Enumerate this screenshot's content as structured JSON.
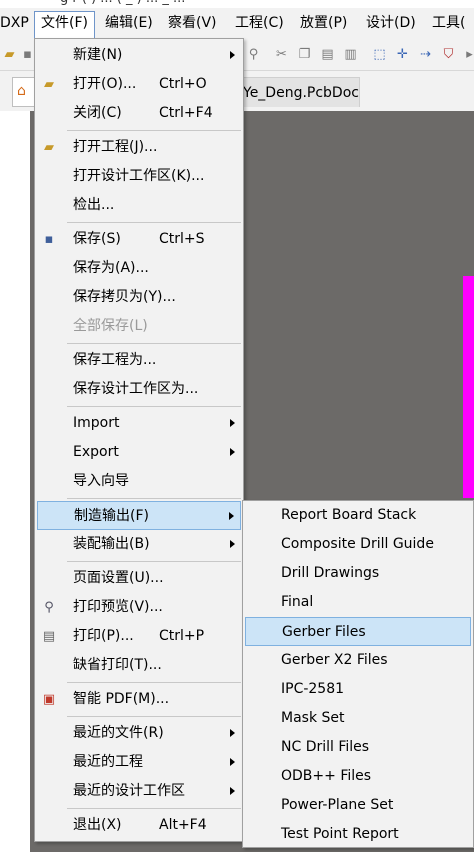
{
  "menubar": {
    "items": [
      "DXP",
      "文件(F)",
      "编辑(E)",
      "察看(V)",
      "工程(C)",
      "放置(P)",
      "设计(D)",
      "工具("
    ]
  },
  "tabs": {
    "document": "Ye_Deng.PcbDoc"
  },
  "file_menu": {
    "items": [
      {
        "label": "新建(N)",
        "shortcut": "",
        "submenu": true
      },
      {
        "label": "打开(O)...",
        "shortcut": "Ctrl+O",
        "icon": "open-folder-icon"
      },
      {
        "label": "关闭(C)",
        "shortcut": "Ctrl+F4"
      },
      {
        "label": "打开工程(J)...",
        "icon": "open-project-icon"
      },
      {
        "label": "打开设计工作区(K)..."
      },
      {
        "label": "检出..."
      },
      {
        "label": "保存(S)",
        "shortcut": "Ctrl+S",
        "icon": "save-icon"
      },
      {
        "label": "保存为(A)..."
      },
      {
        "label": "保存拷贝为(Y)..."
      },
      {
        "label": "全部保存(L)",
        "disabled": true
      },
      {
        "label": "保存工程为..."
      },
      {
        "label": "保存设计工作区为..."
      },
      {
        "label": "Import",
        "submenu": true
      },
      {
        "label": "Export",
        "submenu": true
      },
      {
        "label": "导入向导"
      },
      {
        "label": "制造输出(F)",
        "submenu": true,
        "highlighted": true
      },
      {
        "label": "装配输出(B)",
        "submenu": true
      },
      {
        "label": "页面设置(U)..."
      },
      {
        "label": "打印预览(V)...",
        "icon": "print-preview-icon"
      },
      {
        "label": "打印(P)...",
        "shortcut": "Ctrl+P",
        "icon": "printer-icon"
      },
      {
        "label": "缺省打印(T)..."
      },
      {
        "label": "智能 PDF(M)...",
        "icon": "pdf-icon"
      },
      {
        "label": "最近的文件(R)",
        "submenu": true
      },
      {
        "label": "最近的工程",
        "submenu": true
      },
      {
        "label": "最近的设计工作区",
        "submenu": true
      },
      {
        "label": "退出(X)",
        "shortcut": "Alt+F4"
      }
    ]
  },
  "fabrication_submenu": {
    "items": [
      {
        "label": "Report Board Stack"
      },
      {
        "label": "Composite Drill Guide"
      },
      {
        "label": "Drill Drawings"
      },
      {
        "label": "Final"
      },
      {
        "label": "Gerber Files",
        "highlighted": true
      },
      {
        "label": "Gerber X2 Files"
      },
      {
        "label": "IPC-2581"
      },
      {
        "label": "Mask Set"
      },
      {
        "label": "NC Drill Files"
      },
      {
        "label": "ODB++ Files"
      },
      {
        "label": "Power-Plane Set"
      },
      {
        "label": "Test Point Report"
      }
    ]
  },
  "colors": {
    "highlight": "#cce4f7",
    "workspace": "#6c6a68",
    "board_edge": "#ff00ff"
  }
}
